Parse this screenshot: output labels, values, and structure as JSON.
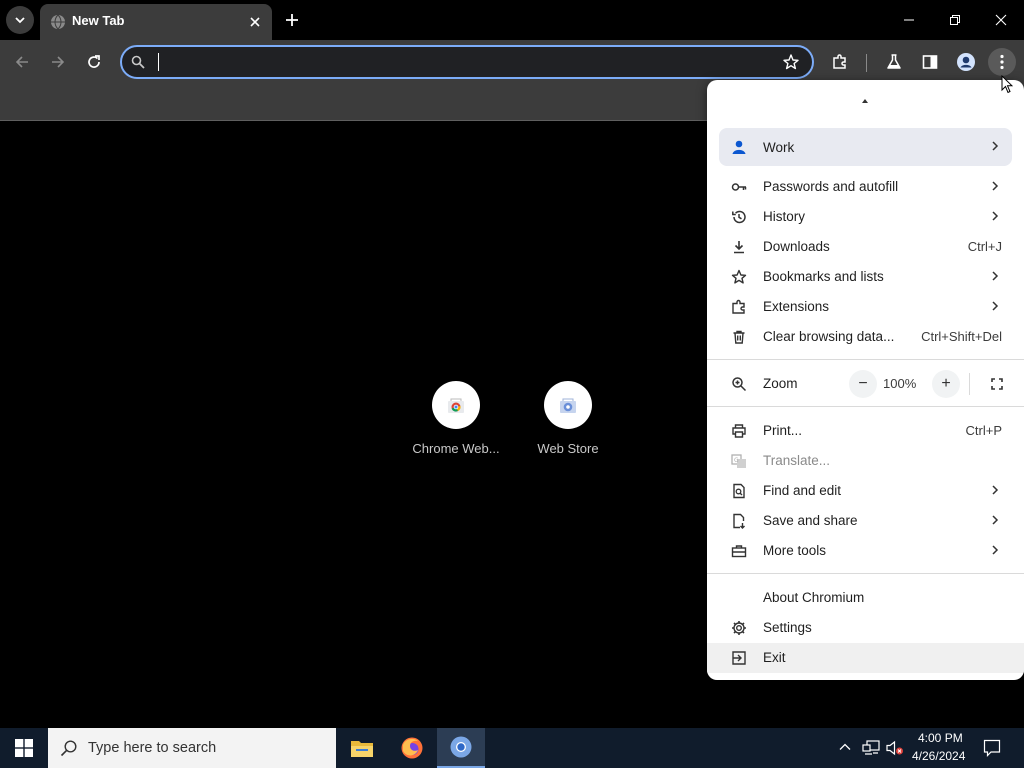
{
  "tab": {
    "title": "New Tab"
  },
  "omnibox": {
    "value": "",
    "placeholder": ""
  },
  "shortcuts": [
    {
      "label": "Chrome Web..."
    },
    {
      "label": "Web Store"
    }
  ],
  "menu": {
    "profile": {
      "label": "Work"
    },
    "items_group1": [
      {
        "label": "Passwords and autofill",
        "shortcut": ""
      },
      {
        "label": "History",
        "shortcut": ""
      },
      {
        "label": "Downloads",
        "shortcut": "Ctrl+J"
      },
      {
        "label": "Bookmarks and lists",
        "shortcut": ""
      },
      {
        "label": "Extensions",
        "shortcut": ""
      },
      {
        "label": "Clear browsing data...",
        "shortcut": "Ctrl+Shift+Del"
      }
    ],
    "zoom": {
      "label": "Zoom",
      "value": "100%",
      "minus": "−",
      "plus": "+"
    },
    "items_group2": [
      {
        "label": "Print...",
        "shortcut": "Ctrl+P"
      },
      {
        "label": "Translate...",
        "shortcut": ""
      },
      {
        "label": "Find and edit",
        "shortcut": ""
      },
      {
        "label": "Save and share",
        "shortcut": ""
      },
      {
        "label": "More tools",
        "shortcut": ""
      }
    ],
    "items_group3": [
      {
        "label": "About Chromium"
      },
      {
        "label": "Settings"
      },
      {
        "label": "Exit"
      }
    ]
  },
  "taskbar": {
    "search_placeholder": "Type here to search",
    "time": "4:00 PM",
    "date": "4/26/2024"
  },
  "colors": {
    "accent": "#7cacf8",
    "toolbar": "#3c3c3c",
    "taskbar": "#101c2c"
  }
}
